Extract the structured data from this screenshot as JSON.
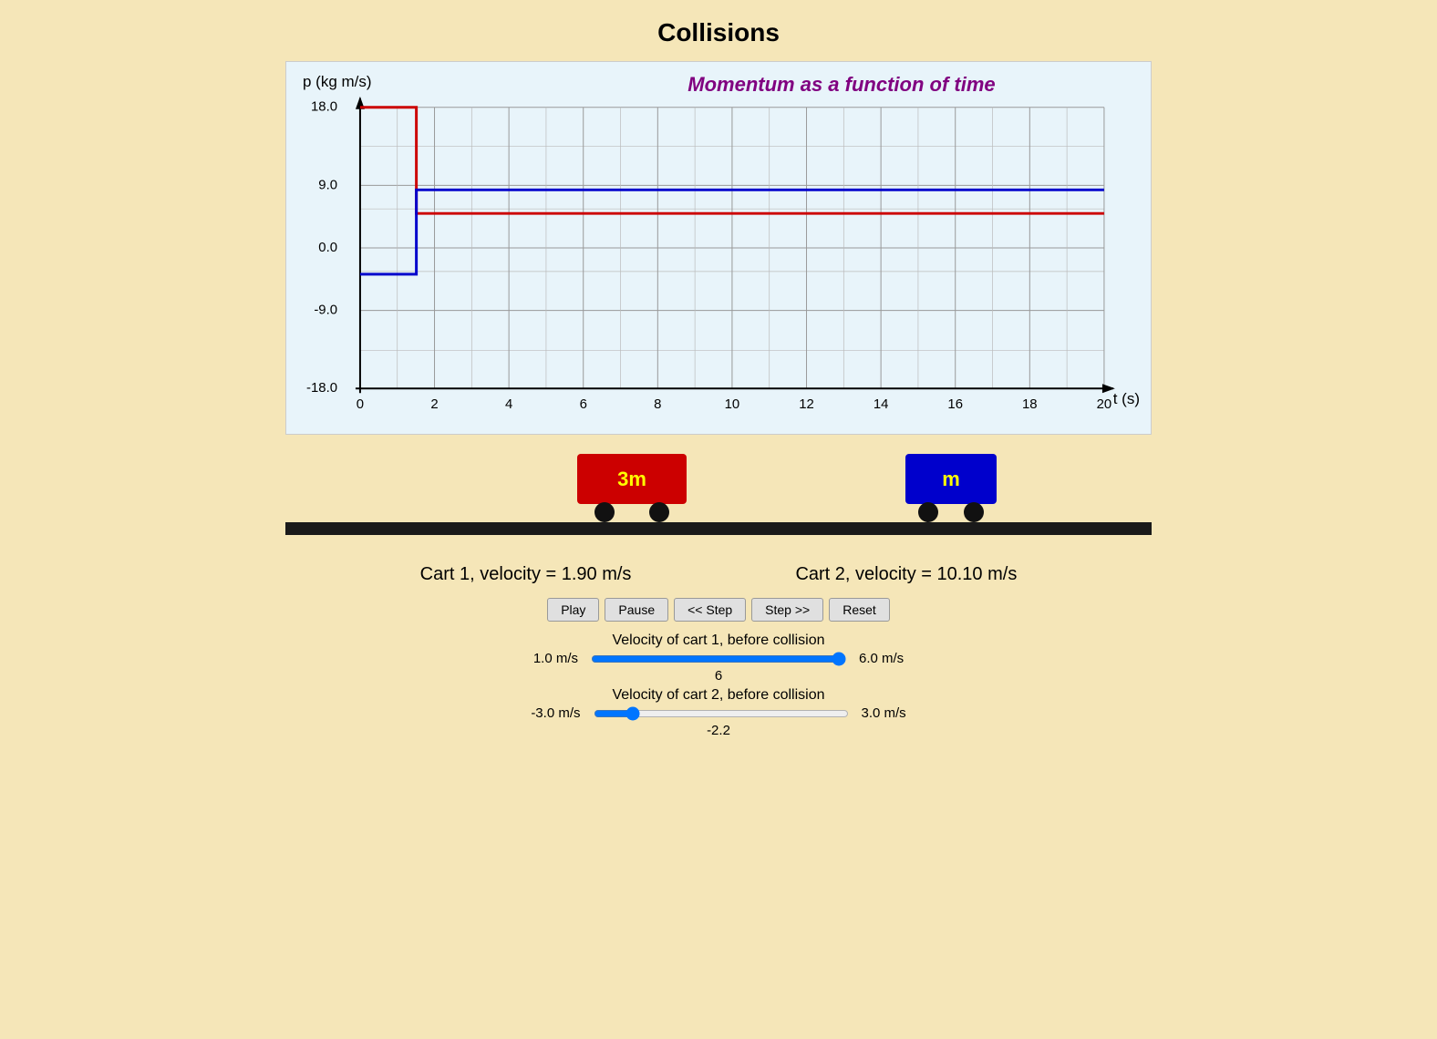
{
  "title": "Collisions",
  "chart": {
    "title": "Momentum as a function of time",
    "y_label": "p (kg m/s)",
    "x_label": "t (s)",
    "y_ticks": [
      "18.0",
      "9.0",
      "0.0",
      "-9.0",
      "-18.0"
    ],
    "x_ticks": [
      "0",
      "2",
      "4",
      "6",
      "8",
      "10",
      "12",
      "14",
      "16",
      "18",
      "20"
    ]
  },
  "cart1": {
    "label": "3m",
    "velocity_text": "Cart 1, velocity = 1.90 m/s"
  },
  "cart2": {
    "label": "m",
    "velocity_text": "Cart 2, velocity = 10.10 m/s"
  },
  "buttons": {
    "play": "Play",
    "pause": "Pause",
    "step_back": "<< Step",
    "step_fwd": "Step >>",
    "reset": "Reset"
  },
  "slider1": {
    "label": "Velocity of cart 1, before collision",
    "min_label": "1.0 m/s",
    "max_label": "6.0 m/s",
    "value": "6",
    "min": 1,
    "max": 6,
    "current": 6
  },
  "slider2": {
    "label": "Velocity of cart 2, before collision",
    "min_label": "-3.0 m/s",
    "max_label": "3.0 m/s",
    "value": "-2.2",
    "min": -3,
    "max": 3,
    "current": -2.2
  }
}
